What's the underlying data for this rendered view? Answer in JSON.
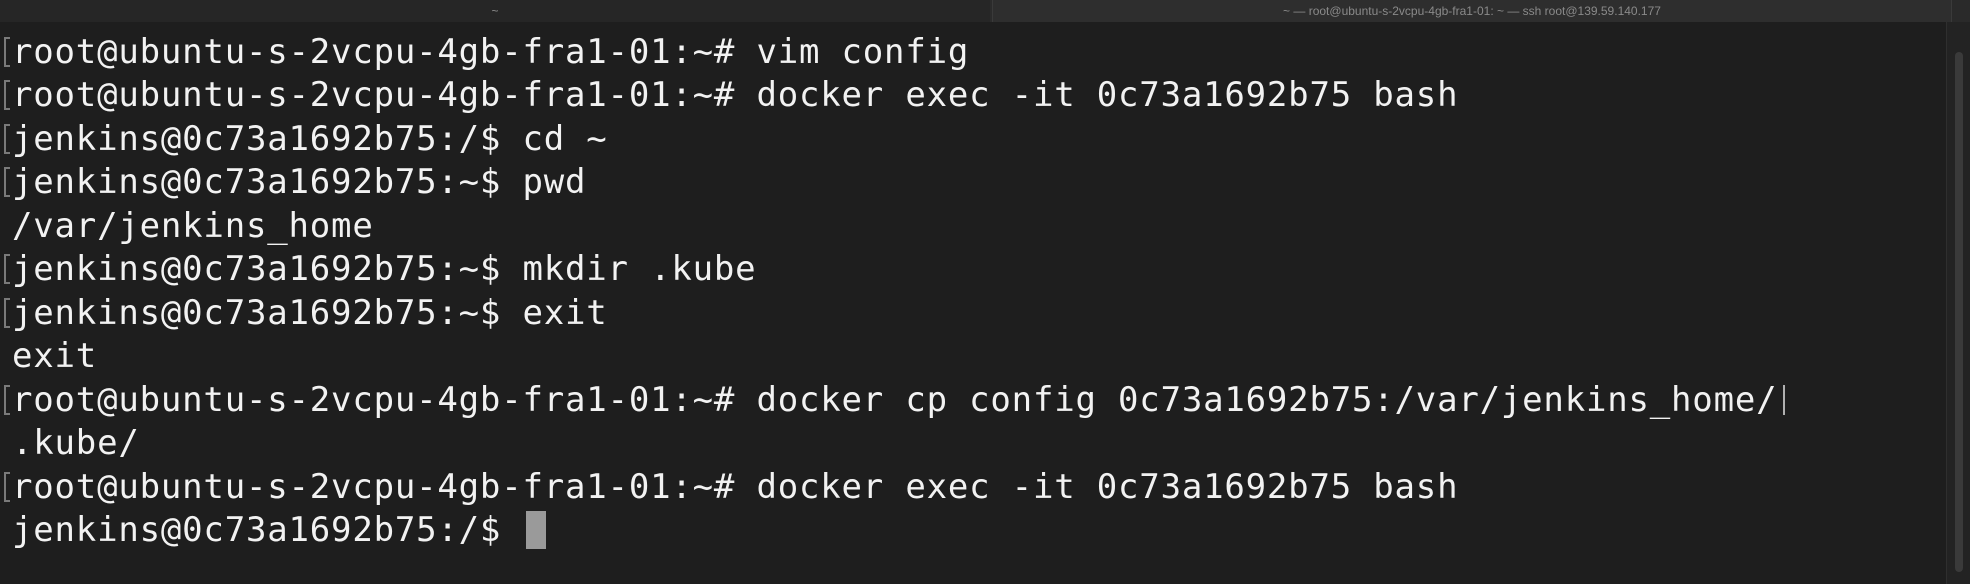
{
  "window": {
    "tabs": [
      {
        "title": "~"
      },
      {
        "title": "~ — root@ubuntu-s-2vcpu-4gb-fra1-01: ~ — ssh root@139.59.140.177"
      }
    ]
  },
  "terminal": {
    "lines": [
      {
        "text": "root@ubuntu-s-2vcpu-4gb-fra1-01:~# vim config"
      },
      {
        "text": "root@ubuntu-s-2vcpu-4gb-fra1-01:~# docker exec -it 0c73a1692b75 bash"
      },
      {
        "text": "jenkins@0c73a1692b75:/$ cd ~"
      },
      {
        "text": "jenkins@0c73a1692b75:~$ pwd"
      },
      {
        "text": "/var/jenkins_home"
      },
      {
        "text": "jenkins@0c73a1692b75:~$ mkdir .kube"
      },
      {
        "text": "jenkins@0c73a1692b75:~$ exit"
      },
      {
        "text": "exit"
      },
      {
        "text": "root@ubuntu-s-2vcpu-4gb-fra1-01:~# docker cp config 0c73a1692b75:/var/jenkins_home/"
      },
      {
        "text": ".kube/"
      },
      {
        "text": "root@ubuntu-s-2vcpu-4gb-fra1-01:~# docker exec -it 0c73a1692b75 bash"
      },
      {
        "text": "jenkins@0c73a1692b75:/$ "
      }
    ]
  }
}
